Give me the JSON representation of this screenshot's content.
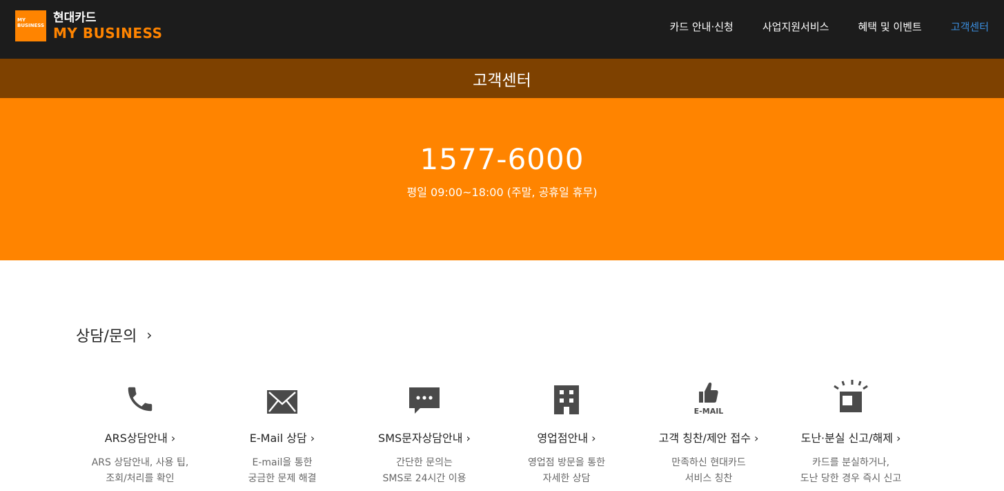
{
  "header": {
    "logo_badge": "MY BUSINESS",
    "logo_top": "현대카드",
    "logo_bottom": "MY BUSINESS",
    "nav": [
      {
        "label": "카드 안내·신청"
      },
      {
        "label": "사업지원서비스"
      },
      {
        "label": "혜택 및 이벤트"
      },
      {
        "label": "고객센터"
      }
    ]
  },
  "page_title": "고객센터",
  "hero": {
    "phone": "1577-6000",
    "hours": "평일 09:00~18:00 (주말, 공휴일 휴무)"
  },
  "section": {
    "title": "상담/문의",
    "chevron": "›",
    "services": [
      {
        "title": "ARS상담안내 ›",
        "desc": "ARS 상담안내, 사용 팁,\n조회/처리를 확인",
        "icon": "phone-icon"
      },
      {
        "title": "E-Mail 상담 ›",
        "desc": "E-mail을 통한\n궁금한 문제 해결",
        "icon": "envelope-icon"
      },
      {
        "title": "SMS문자상담안내 ›",
        "desc": "간단한 문의는\nSMS로 24시간 이용",
        "icon": "chat-bubble-icon"
      },
      {
        "title": "영업점안내 ›",
        "desc": "영업점 방문을 통한\n자세한 상담",
        "icon": "building-icon"
      },
      {
        "title": "고객 칭찬/제안 접수 ›",
        "desc": "만족하신 현대카드\n서비스 칭찬",
        "icon": "thumbs-up-email-icon",
        "icon_text": "E-MAIL"
      },
      {
        "title": "도난·분실 신고/해제 ›",
        "desc": "카드를 분실하거나,\n도난 당한 경우 즉시 신고",
        "icon": "alert-card-icon"
      }
    ]
  },
  "colors": {
    "header_bg": "#1c1c1c",
    "brand_orange": "#ff8400",
    "subtitle_brown": "#7e4100",
    "nav_active": "#3b8fe0",
    "icon_gray": "#4a4a4a"
  }
}
